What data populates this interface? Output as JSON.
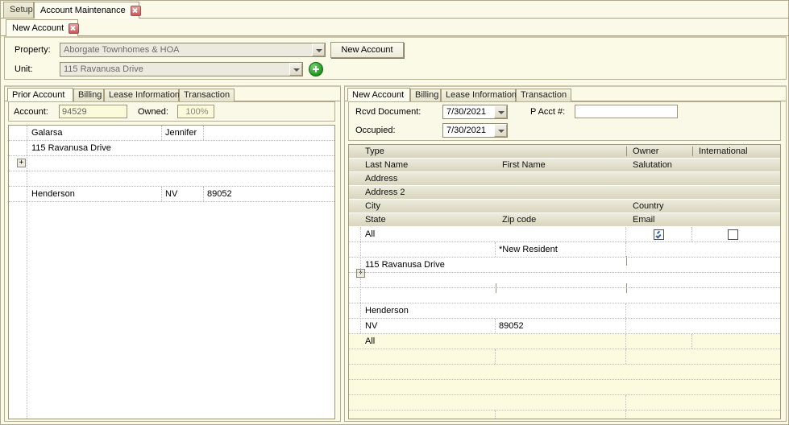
{
  "window": {
    "main_tabs": [
      {
        "label": "Setup",
        "selected": false,
        "closable": false
      },
      {
        "label": "Account Maintenance",
        "selected": true,
        "closable": true
      }
    ],
    "sub_tabs": [
      {
        "label": "New Account",
        "selected": true,
        "closable": true
      }
    ]
  },
  "header": {
    "property_label": "Property:",
    "property_value": "Aborgate Townhomes & HOA",
    "unit_label": "Unit:",
    "unit_value": "115 Ravanusa Drive",
    "new_account_button": "New Account",
    "add_unit_icon": "plus-circle-icon"
  },
  "left_panel": {
    "tabs": [
      {
        "label": "Prior Account",
        "selected": true
      },
      {
        "label": "Billing",
        "selected": false
      },
      {
        "label": "Lease Information",
        "selected": false
      },
      {
        "label": "Transaction",
        "selected": false
      }
    ],
    "account_label": "Account:",
    "account_value": "94529",
    "owned_label": "Owned:",
    "owned_value": "100%",
    "expand_icon": "+",
    "rows": [
      {
        "c1": "Galarsa",
        "c2": "Jennifer",
        "c3": ""
      },
      {
        "c1": "115 Ravanusa Drive",
        "c2": "",
        "c3": ""
      },
      {
        "c1": "",
        "c2": "",
        "c3": ""
      },
      {
        "c1": "",
        "c2": "",
        "c3": ""
      },
      {
        "c1": "Henderson",
        "c2": "NV",
        "c3": "89052"
      }
    ]
  },
  "right_panel": {
    "tabs": [
      {
        "label": "New Account",
        "selected": true
      },
      {
        "label": "Billing",
        "selected": false
      },
      {
        "label": "Lease Information",
        "selected": false
      },
      {
        "label": "Transaction",
        "selected": false
      }
    ],
    "rcvd_document_label": "Rcvd Document:",
    "rcvd_document_value": "7/30/2021",
    "occupied_label": "Occupied:",
    "occupied_value": "7/30/2021",
    "p_acct_label": "P Acct #:",
    "p_acct_value": "",
    "expand_icon": "+",
    "header_rows": [
      {
        "c1": "Type",
        "c2": "",
        "c3": "Owner",
        "c4": "International"
      },
      {
        "c1": "Last Name",
        "c2": "First Name",
        "c3": "Salutation",
        "c4": ""
      },
      {
        "c1": "Address",
        "c2": "",
        "c3": "",
        "c4": ""
      },
      {
        "c1": "Address 2",
        "c2": "",
        "c3": "",
        "c4": ""
      },
      {
        "c1": "City",
        "c2": "",
        "c3": "Country",
        "c4": ""
      },
      {
        "c1": "State",
        "c2": "Zip code",
        "c3": "Email",
        "c4": ""
      }
    ],
    "data_rows": [
      {
        "c1": "All",
        "c2": "",
        "c3": "",
        "c4": "",
        "yellow": false,
        "owner_checked": true,
        "intl_checked": false
      },
      {
        "c1": "",
        "c2": "*New Resident",
        "c3": "",
        "c4": "",
        "yellow": false
      },
      {
        "c1": "115 Ravanusa Drive",
        "c2": "",
        "c3": "",
        "c4": "",
        "yellow": false
      },
      {
        "c1": "",
        "c2": "",
        "c3": "",
        "c4": "",
        "yellow": false
      },
      {
        "c1": "",
        "c2": "",
        "c3": "",
        "c4": "",
        "yellow": false
      },
      {
        "c1": "Henderson",
        "c2": "",
        "c3": "",
        "c4": "",
        "yellow": false
      },
      {
        "c1": "NV",
        "c2": "89052",
        "c3": "",
        "c4": "",
        "yellow": false
      },
      {
        "c1": "All",
        "c2": "",
        "c3": "",
        "c4": "",
        "yellow": true
      },
      {
        "c1": "",
        "c2": "",
        "c3": "",
        "c4": "",
        "yellow": true
      },
      {
        "c1": "",
        "c2": "",
        "c3": "",
        "c4": "",
        "yellow": true
      },
      {
        "c1": "",
        "c2": "",
        "c3": "",
        "c4": "",
        "yellow": true
      },
      {
        "c1": "",
        "c2": "",
        "c3": "",
        "c4": "",
        "yellow": true
      },
      {
        "c1": "",
        "c2": "",
        "c3": "",
        "c4": "",
        "yellow": true
      }
    ]
  },
  "colors": {
    "window_bg": "#fbfae7",
    "border": "#b5ae90",
    "grid_header": "#d9d5bd",
    "readonly_field": "#fbfada",
    "yellow_row": "#fcfbdf",
    "close_icon": "#c85a5a",
    "add_icon": "#1f9a1f",
    "check": "#2b5ca8"
  }
}
